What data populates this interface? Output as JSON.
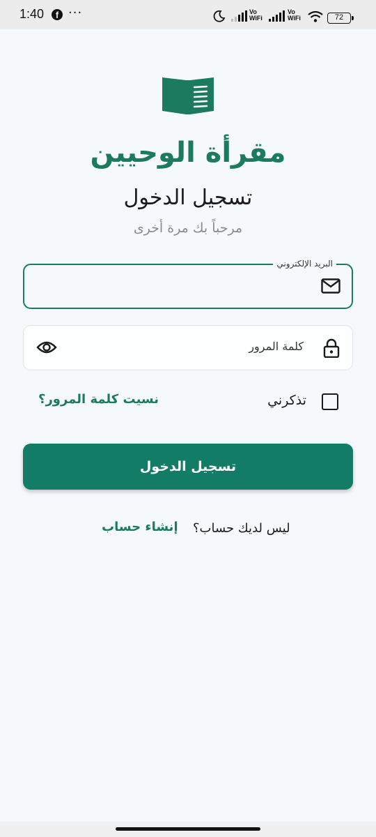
{
  "status_bar": {
    "time": "1:40",
    "facebook_glyph": "f",
    "more": "···",
    "network_label_1": "Vo\nWiFi",
    "network_label_2": "Vo\nWiFi",
    "battery_level": "72",
    "icons": [
      "facebook-icon",
      "more-icon",
      "moon-icon",
      "signal-icon",
      "vowifi-icon",
      "signal-icon",
      "vowifi-icon",
      "wifi-icon",
      "battery-icon"
    ]
  },
  "app": {
    "name": "مقرأة الوحيين",
    "logo_icon": "book-icon",
    "accent_color": "#1c7a5e"
  },
  "login": {
    "title": "تسجيل الدخول",
    "subtitle": "مرحباً بك مرة أخرى",
    "email_label": "البريد الإلكتروني",
    "email_value": "",
    "password_placeholder": "كلمة المرور",
    "remember_me": "تذكرني",
    "remember_checked": false,
    "forgot_password": "نسيت كلمة المرور؟",
    "submit": "تسجيل الدخول",
    "no_account": "ليس لديك حساب؟",
    "create_account": "إنشاء حساب"
  }
}
